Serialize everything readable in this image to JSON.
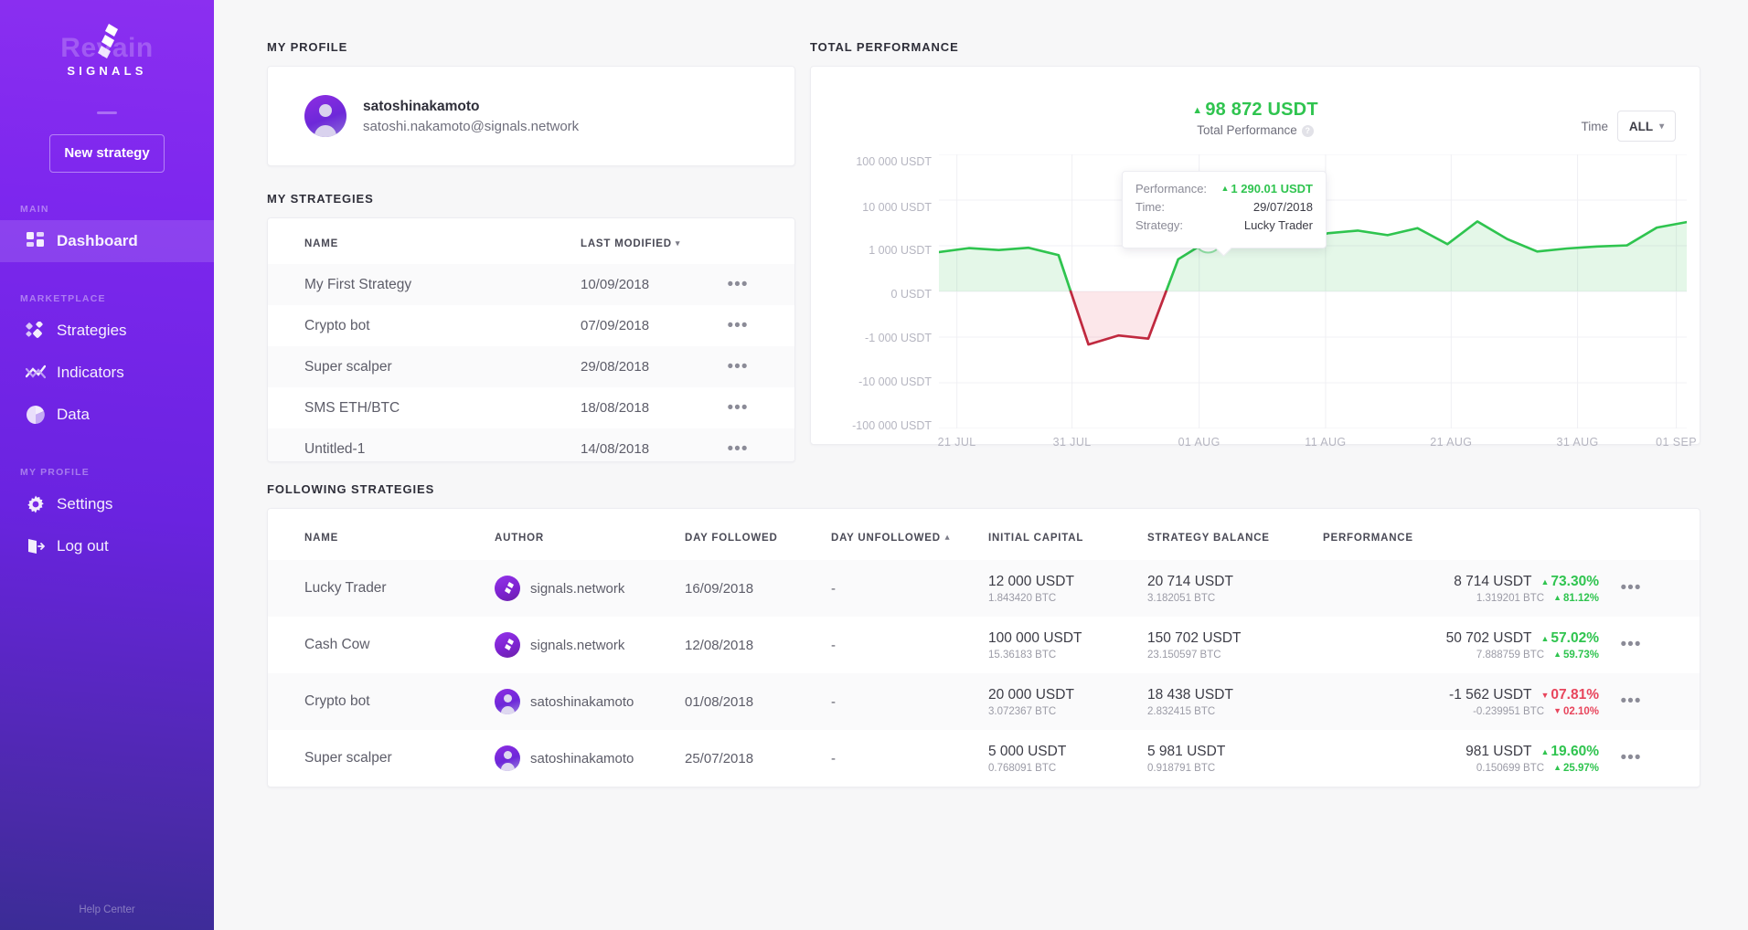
{
  "sidebar": {
    "logo_word": "Revain",
    "logo_sub": "SIGNALS",
    "new_strategy_label": "New strategy",
    "sections": [
      {
        "label": "MAIN",
        "items": [
          {
            "label": "Dashboard",
            "icon": "dashboard-icon",
            "active": true
          }
        ]
      },
      {
        "label": "MARKETPLACE",
        "items": [
          {
            "label": "Strategies",
            "icon": "strategies-icon",
            "active": false
          },
          {
            "label": "Indicators",
            "icon": "indicators-icon",
            "active": false
          },
          {
            "label": "Data",
            "icon": "data-icon",
            "active": false
          }
        ]
      },
      {
        "label": "MY PROFILE",
        "items": [
          {
            "label": "Settings",
            "icon": "gear-icon",
            "active": false
          },
          {
            "label": "Log out",
            "icon": "logout-icon",
            "active": false
          }
        ]
      }
    ],
    "help_center": "Help Center"
  },
  "profile": {
    "section_title": "MY PROFILE",
    "name": "satoshinakamoto",
    "email": "satoshi.nakamoto@signals.network"
  },
  "my_strategies": {
    "section_title": "MY STRATEGIES",
    "columns": [
      "NAME",
      "LAST MODIFIED"
    ],
    "sort_column": "LAST MODIFIED",
    "sort_direction": "desc",
    "rows": [
      {
        "name": "My First Strategy",
        "last_modified": "10/09/2018",
        "menu": "•••"
      },
      {
        "name": "Crypto bot",
        "last_modified": "07/09/2018",
        "menu": "•••"
      },
      {
        "name": "Super scalper",
        "last_modified": "29/08/2018",
        "menu": "•••"
      },
      {
        "name": "SMS ETH/BTC",
        "last_modified": "18/08/2018",
        "menu": "•••"
      },
      {
        "name": "Untitled-1",
        "last_modified": "14/08/2018",
        "menu": "•••"
      }
    ]
  },
  "performance": {
    "section_title": "TOTAL PERFORMANCE",
    "kpi_value": "98 872 USDT",
    "kpi_label": "Total Performance",
    "kpi_info": "?",
    "time_label": "Time",
    "time_value": "ALL",
    "tooltip": {
      "performance_key": "Performance:",
      "performance_value": "1 290.01 USDT",
      "time_key": "Time:",
      "time_value": "29/07/2018",
      "strategy_key": "Strategy:",
      "strategy_value": "Lucky Trader"
    }
  },
  "chart_data": {
    "type": "area",
    "title": "Total Performance",
    "xlabel": "",
    "ylabel": "USDT",
    "scale": "symlog",
    "grid": true,
    "legend": false,
    "colors": {
      "positive": "#2fc44f",
      "negative": "#c0293f",
      "fill_positive": "#d9f5dd",
      "fill_negative": "#fbdfe3"
    },
    "ytick_labels": [
      "100 000 USDT",
      "10 000 USDT",
      "1 000 USDT",
      "0 USDT",
      "-1 000 USDT",
      "-10 000 USDT",
      "-100 000 USDT"
    ],
    "ytick_values": [
      100000,
      10000,
      1000,
      0,
      -1000,
      -10000,
      -100000
    ],
    "xtick_labels": [
      "21 JUL",
      "31 JUL",
      "01 AUG",
      "11 AUG",
      "21 AUG",
      "31 AUG",
      "01 SEP"
    ],
    "highlight_point": {
      "x_label": "29/07/2018",
      "y_value": 1290.01,
      "strategy": "Lucky Trader"
    },
    "x": [
      0,
      1,
      2,
      3,
      4,
      5,
      6,
      7,
      8,
      9,
      10,
      11,
      12,
      13,
      14,
      15,
      16,
      17,
      18,
      19,
      20,
      21,
      22,
      23,
      24,
      25
    ],
    "values": [
      380,
      700,
      520,
      740,
      240,
      -1450,
      -780,
      -1080,
      130,
      1290,
      1300,
      1540,
      1080,
      1880,
      2150,
      1710,
      2430,
      1080,
      3400,
      1400,
      420,
      660,
      900,
      1020,
      2500,
      3300
    ]
  },
  "following": {
    "section_title": "FOLLOWING STRATEGIES",
    "columns": [
      "NAME",
      "AUTHOR",
      "DAY FOLLOWED",
      "DAY UNFOLLOWED",
      "INITIAL CAPITAL",
      "STRATEGY BALANCE",
      "PERFORMANCE"
    ],
    "sort_column": "DAY UNFOLLOWED",
    "sort_direction": "asc",
    "rows": [
      {
        "name": "Lucky Trader",
        "author": "signals.network",
        "author_avatar": "signals-logo-avatar",
        "day_followed": "16/09/2018",
        "day_unfollowed": "-",
        "initial_usdt": "12 000 USDT",
        "initial_btc": "1.843420 BTC",
        "balance_usdt": "20 714 USDT",
        "balance_btc": "3.182051 BTC",
        "perf_usdt": "8 714 USDT",
        "perf_pct": "73.30%",
        "perf_btc": "1.319201 BTC",
        "perf_btc_pct": "81.12%",
        "direction": "up",
        "menu": "•••"
      },
      {
        "name": "Cash Cow",
        "author": "signals.network",
        "author_avatar": "signals-logo-avatar",
        "day_followed": "12/08/2018",
        "day_unfollowed": "-",
        "initial_usdt": "100 000 USDT",
        "initial_btc": "15.36183 BTC",
        "balance_usdt": "150 702 USDT",
        "balance_btc": "23.150597 BTC",
        "perf_usdt": "50 702 USDT",
        "perf_pct": "57.02%",
        "perf_btc": "7.888759 BTC",
        "perf_btc_pct": "59.73%",
        "direction": "up",
        "menu": "•••"
      },
      {
        "name": "Crypto bot",
        "author": "satoshinakamoto",
        "author_avatar": "user-avatar",
        "day_followed": "01/08/2018",
        "day_unfollowed": "-",
        "initial_usdt": "20 000 USDT",
        "initial_btc": "3.072367 BTC",
        "balance_usdt": "18 438 USDT",
        "balance_btc": "2.832415 BTC",
        "perf_usdt": "-1 562 USDT",
        "perf_pct": "07.81%",
        "perf_btc": "-0.239951 BTC",
        "perf_btc_pct": "02.10%",
        "direction": "down",
        "menu": "•••"
      },
      {
        "name": "Super scalper",
        "author": "satoshinakamoto",
        "author_avatar": "user-avatar",
        "day_followed": "25/07/2018",
        "day_unfollowed": "-",
        "initial_usdt": "5 000 USDT",
        "initial_btc": "0.768091 BTC",
        "balance_usdt": "5 981 USDT",
        "balance_btc": "0.918791 BTC",
        "perf_usdt": "981 USDT",
        "perf_pct": "19.60%",
        "perf_btc": "0.150699 BTC",
        "perf_btc_pct": "25.97%",
        "direction": "up",
        "menu": "•••"
      }
    ]
  }
}
